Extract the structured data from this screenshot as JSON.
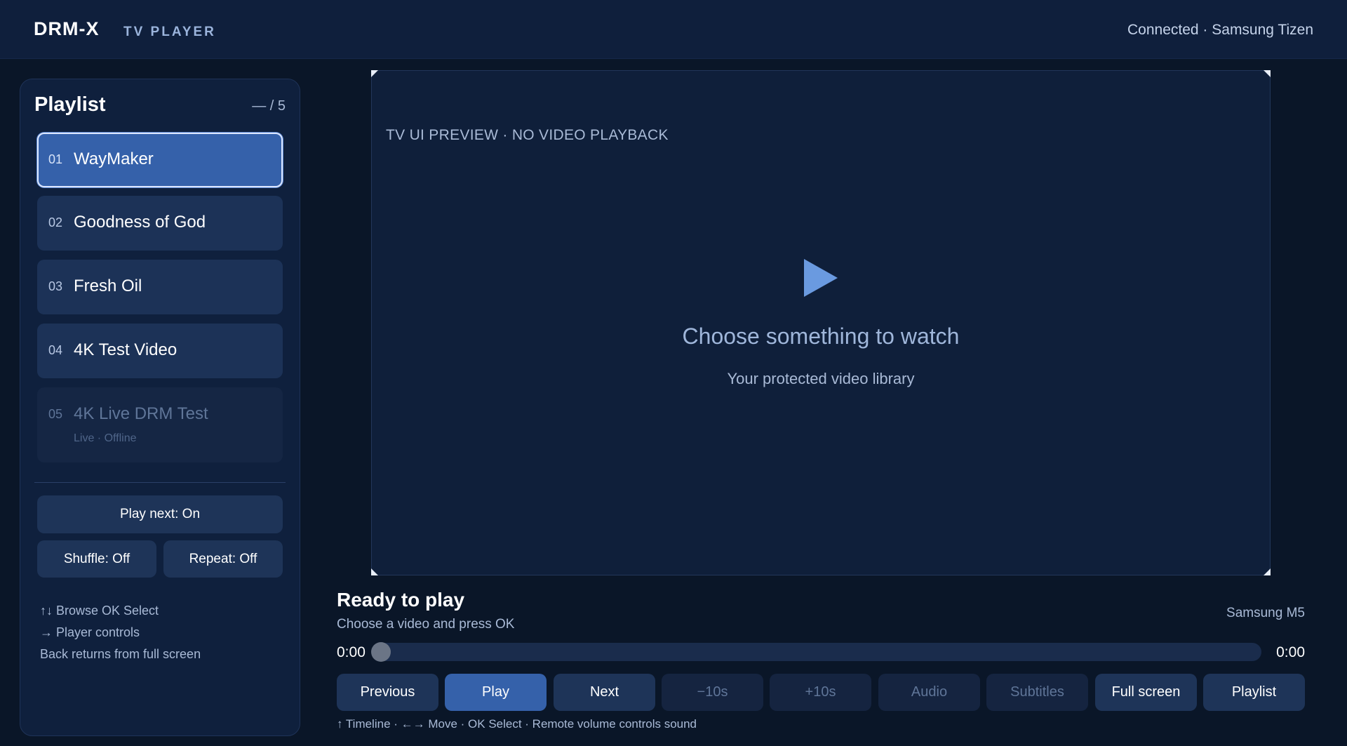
{
  "header": {
    "brand": "DRM-X",
    "subtitle": "TV PLAYER",
    "status": "Connected · Samsung Tizen"
  },
  "sidebar": {
    "title": "Playlist",
    "count": "— / 5",
    "items": [
      {
        "num": "01",
        "name": "WayMaker",
        "state": "active"
      },
      {
        "num": "02",
        "name": "Goodness of God",
        "state": "normal"
      },
      {
        "num": "03",
        "name": "Fresh Oil",
        "state": "normal"
      },
      {
        "num": "04",
        "name": "4K Test Video",
        "state": "normal"
      },
      {
        "num": "05",
        "name": "4K Live DRM Test",
        "sub": "Live · Offline",
        "state": "offline"
      }
    ],
    "play_next": "Play next: On",
    "shuffle": "Shuffle: Off",
    "repeat": "Repeat: Off",
    "hints": [
      "↑↓ Browse   OK Select",
      "→ Player controls",
      "Back returns from full screen"
    ]
  },
  "video": {
    "preview_label": "TV UI PREVIEW · NO VIDEO PLAYBACK",
    "headline": "Choose something to watch",
    "subline": "Your protected video library",
    "play_icon": "play-icon"
  },
  "status": {
    "title": "Ready to play",
    "subtitle": "Choose a video and press OK",
    "device": "Samsung M5",
    "time_current": "0:00",
    "time_total": "0:00",
    "progress": 0
  },
  "controls": [
    {
      "label": "Previous",
      "state": "normal"
    },
    {
      "label": "Play",
      "state": "primary"
    },
    {
      "label": "Next",
      "state": "normal"
    },
    {
      "label": "−10s",
      "state": "disabled"
    },
    {
      "label": "+10s",
      "state": "disabled"
    },
    {
      "label": "Audio",
      "state": "disabled"
    },
    {
      "label": "Subtitles",
      "state": "disabled"
    },
    {
      "label": "Full screen",
      "state": "normal"
    },
    {
      "label": "Playlist",
      "state": "normal"
    }
  ],
  "footer_hint": "↑ Timeline · ←→ Move · OK Select · Remote volume controls sound",
  "colors": {
    "background": "#0a1628",
    "accent": "#3561aa",
    "panel": "#0f203d",
    "button": "#1e3458"
  }
}
